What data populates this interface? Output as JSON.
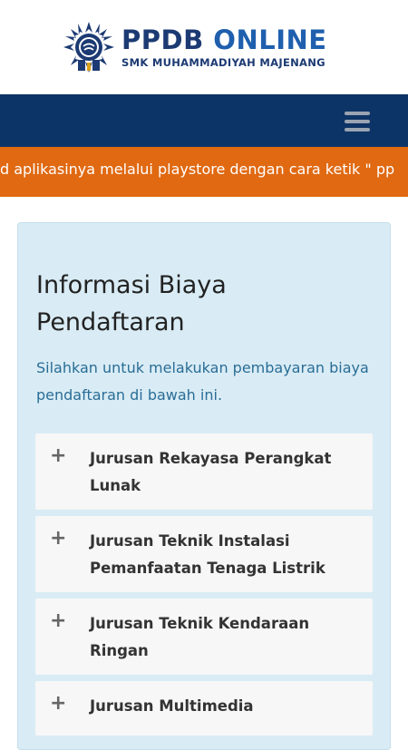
{
  "header": {
    "logo_title_main": "PPDB",
    "logo_title_accent": "ONLINE",
    "logo_subtitle": "SMK MUHAMMADIYAH MAJENANG"
  },
  "marquee": {
    "text": "d aplikasinya melalui playstore dengan cara ketik \" pp"
  },
  "panel": {
    "title": "Informasi Biaya Pendaftaran",
    "description": "Silahkan untuk melakukan pembayaran biaya pendaftaran di bawah ini.",
    "items": [
      {
        "icon": "+",
        "label": "Jurusan Rekayasa Perangkat Lunak"
      },
      {
        "icon": "+",
        "label": "Jurusan Teknik Instalasi Pemanfaatan Tenaga Listrik"
      },
      {
        "icon": "+",
        "label": "Jurusan Teknik Kendaraan Ringan"
      },
      {
        "icon": "+",
        "label": "Jurusan Multimedia"
      }
    ]
  },
  "colors": {
    "navbar": "#0d3466",
    "marquee": "#e06912",
    "panel": "#d9ecf5",
    "brand_dark": "#1c3a73",
    "brand_accent": "#1f5fae"
  }
}
